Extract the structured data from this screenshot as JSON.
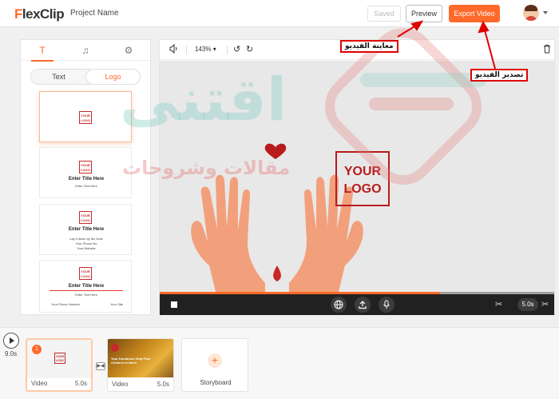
{
  "header": {
    "logo_text": "lexClip",
    "logo_letter": "F",
    "project_name": "Project Name",
    "saved_label": "Saved",
    "preview_label": "Preview",
    "export_label": "Export Video"
  },
  "left_panel": {
    "tab_text_icon": "T",
    "tab_music_icon": "♫",
    "tab_settings_icon": "⚙",
    "toggle": {
      "text_label": "Text",
      "logo_label": "Logo",
      "active": "Logo"
    },
    "templates": [
      {
        "logo_text_1": "YOUR",
        "logo_text_2": "LOGO"
      },
      {
        "logo_text_1": "YOUR",
        "logo_text_2": "LOGO",
        "title": "Enter Title Here",
        "subtitle": "Enter Text Here"
      },
      {
        "logo_text_1": "YOUR",
        "logo_text_2": "LOGO",
        "title": "Enter Title Here",
        "line1": "Lay it down by the Note",
        "line2": "Your Phone No",
        "line3": "Your Website"
      },
      {
        "logo_text_1": "YOUR",
        "logo_text_2": "LOGO",
        "title": "Enter Title Here",
        "subtitle": "Enter Text Here",
        "footer_left": "Your Phone Number",
        "footer_right": "Your Site"
      }
    ]
  },
  "preview": {
    "zoom": "143%",
    "logo_text_1": "YOUR",
    "logo_text_2": "LOGO",
    "progress_fraction": 0.71,
    "duration": "5.0s",
    "accent_color": "#ff6a2a",
    "logo_color": "#b71c1c"
  },
  "timeline": {
    "total_time": "9.0s",
    "clips": [
      {
        "badge": "1",
        "label": "Video",
        "duration": "5.0s",
        "thumb_text_1": "YOUR",
        "thumb_text_2": "LOGO"
      },
      {
        "label": "Video",
        "duration": "5.0s",
        "thumb_text": "Your Donations Help Poor Children In Need"
      }
    ],
    "storyboard_label": "Storyboard"
  },
  "annotations": {
    "preview_ar": "معاينة الفيديو",
    "export_ar": "تصدير الفيديو"
  },
  "watermark": {
    "brand_ar": "اقتنى",
    "tagline_ar": "مقالات وشروحات"
  }
}
